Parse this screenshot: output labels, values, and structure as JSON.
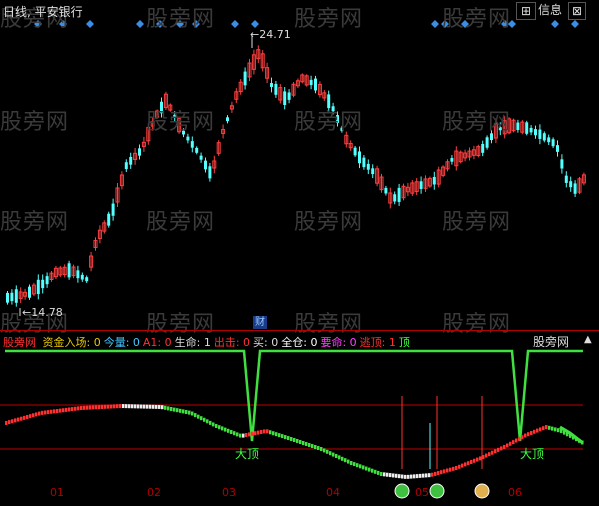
{
  "header": {
    "period": "日线",
    "stock_name": "平安银行",
    "btn_chart": "⊞",
    "btn_info": "信息",
    "btn_close": "⊠"
  },
  "price_labels": {
    "high": "24.71",
    "low": "14.78"
  },
  "cai_marker": "财",
  "watermark": "股旁网",
  "indicator_legend": {
    "title": "股旁网",
    "items": [
      {
        "label": "资金入场:",
        "value": "0",
        "color": "#e8c800"
      },
      {
        "label": "今量:",
        "value": "0",
        "color": "#46c8ff"
      },
      {
        "label": "A1:",
        "value": "0",
        "color": "#ff3030"
      },
      {
        "label": "生命:",
        "value": "1",
        "color": "#dddddd"
      },
      {
        "label": "出击:",
        "value": "0",
        "color": "#ff3030"
      },
      {
        "label": "买:",
        "value": "0",
        "color": "#dddddd"
      },
      {
        "label": "全仓:",
        "value": "0",
        "color": "#ffffff"
      },
      {
        "label": "要命:",
        "value": "0",
        "color": "#ff40ff"
      },
      {
        "label": "逃顶:",
        "value": "1",
        "color": "#ff3030"
      },
      {
        "label": "顶",
        "value": "",
        "color": "#40ff40"
      }
    ],
    "right_label": "股旁网"
  },
  "signals": {
    "top_label_1": "大顶",
    "top_label_2": "大顶"
  },
  "x_axis": [
    "01",
    "02",
    "03",
    "04",
    "05",
    "06"
  ],
  "colors": {
    "up": "#ff4040",
    "down": "#54ffff",
    "green_line": "#40e040",
    "diamond": "#3a8ee6"
  }
}
